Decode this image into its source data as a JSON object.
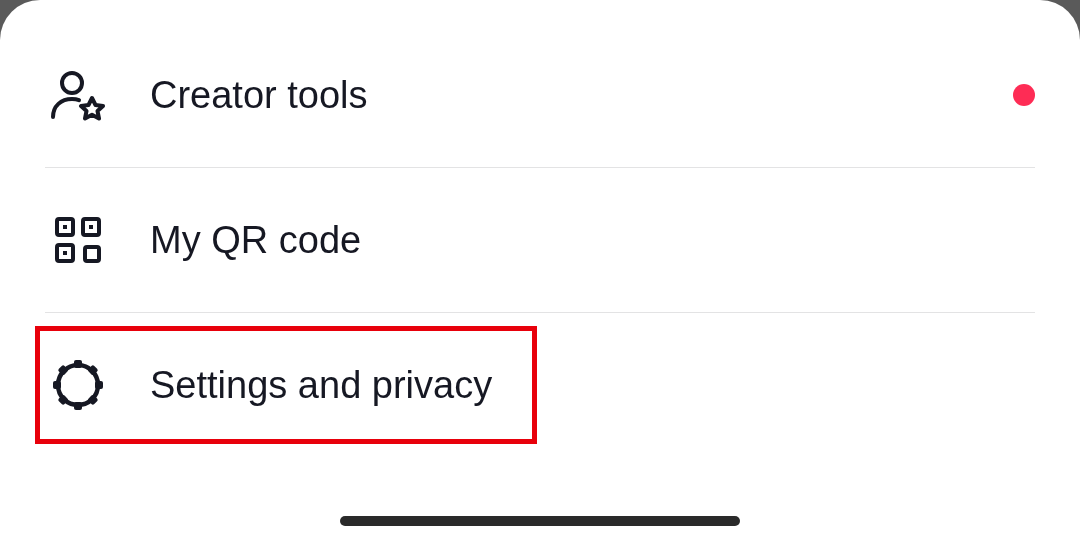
{
  "menu_items": [
    {
      "kind": "creator",
      "label": "Creator tools",
      "badge": true,
      "highlighted": false
    },
    {
      "kind": "qr",
      "label": "My QR code",
      "badge": false,
      "highlighted": false
    },
    {
      "kind": "settings",
      "label": "Settings and privacy",
      "badge": false,
      "highlighted": true
    }
  ]
}
